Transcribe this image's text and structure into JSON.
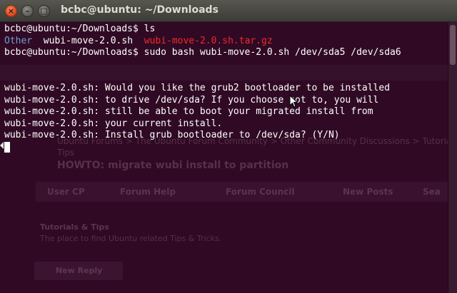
{
  "window": {
    "title": "bcbc@ubuntu: ~/Downloads",
    "close_glyph": "×",
    "minimize_glyph": "–",
    "maximize_glyph": "□"
  },
  "ghost_page": {
    "breadcrumb_line1": "Ubuntu Forums > The Ubuntu Forum Community > Other Community Discussions > Tutorials &",
    "breadcrumb_line2": "Tips",
    "thread_title": "HOWTO: migrate wubi install to partition",
    "nav_items": [
      "User CP",
      "Forum Help",
      "Forum Council",
      "New Posts",
      "Sea"
    ],
    "section_title": "Tutorials & Tips",
    "section_desc": "The place to find Ubuntu related Tips & Tricks.",
    "button_label": "New Reply"
  },
  "terminal": {
    "prompt1": "bcbc@ubuntu:~/Downloads$ ",
    "cmd1": "ls",
    "ls_dir": "Other",
    "ls_sep1": "  ",
    "ls_file": "wubi-move-2.0.sh",
    "ls_sep2": "  ",
    "ls_archive": "wubi-move-2.0.sh.tar.gz",
    "prompt2": "bcbc@ubuntu:~/Downloads$ ",
    "cmd2": "sudo bash wubi-move-2.0.sh /dev/sda5 /dev/sda6",
    "output": [
      "wubi-move-2.0.sh: Would you like the grub2 bootloader to be installed",
      "wubi-move-2.0.sh: to drive /dev/sda? If you choose not to, you will",
      "wubi-move-2.0.sh: still be able to boot your migrated install from",
      "wubi-move-2.0.sh: your current install.",
      "wubi-move-2.0.sh: Install grub bootloader to /dev/sda? (Y/N)"
    ]
  },
  "colors": {
    "terminal_bg": "#300a24",
    "directory": "#729fcf",
    "archive": "#ef2929",
    "text": "#ffffff",
    "close_button": "#e0501f"
  }
}
